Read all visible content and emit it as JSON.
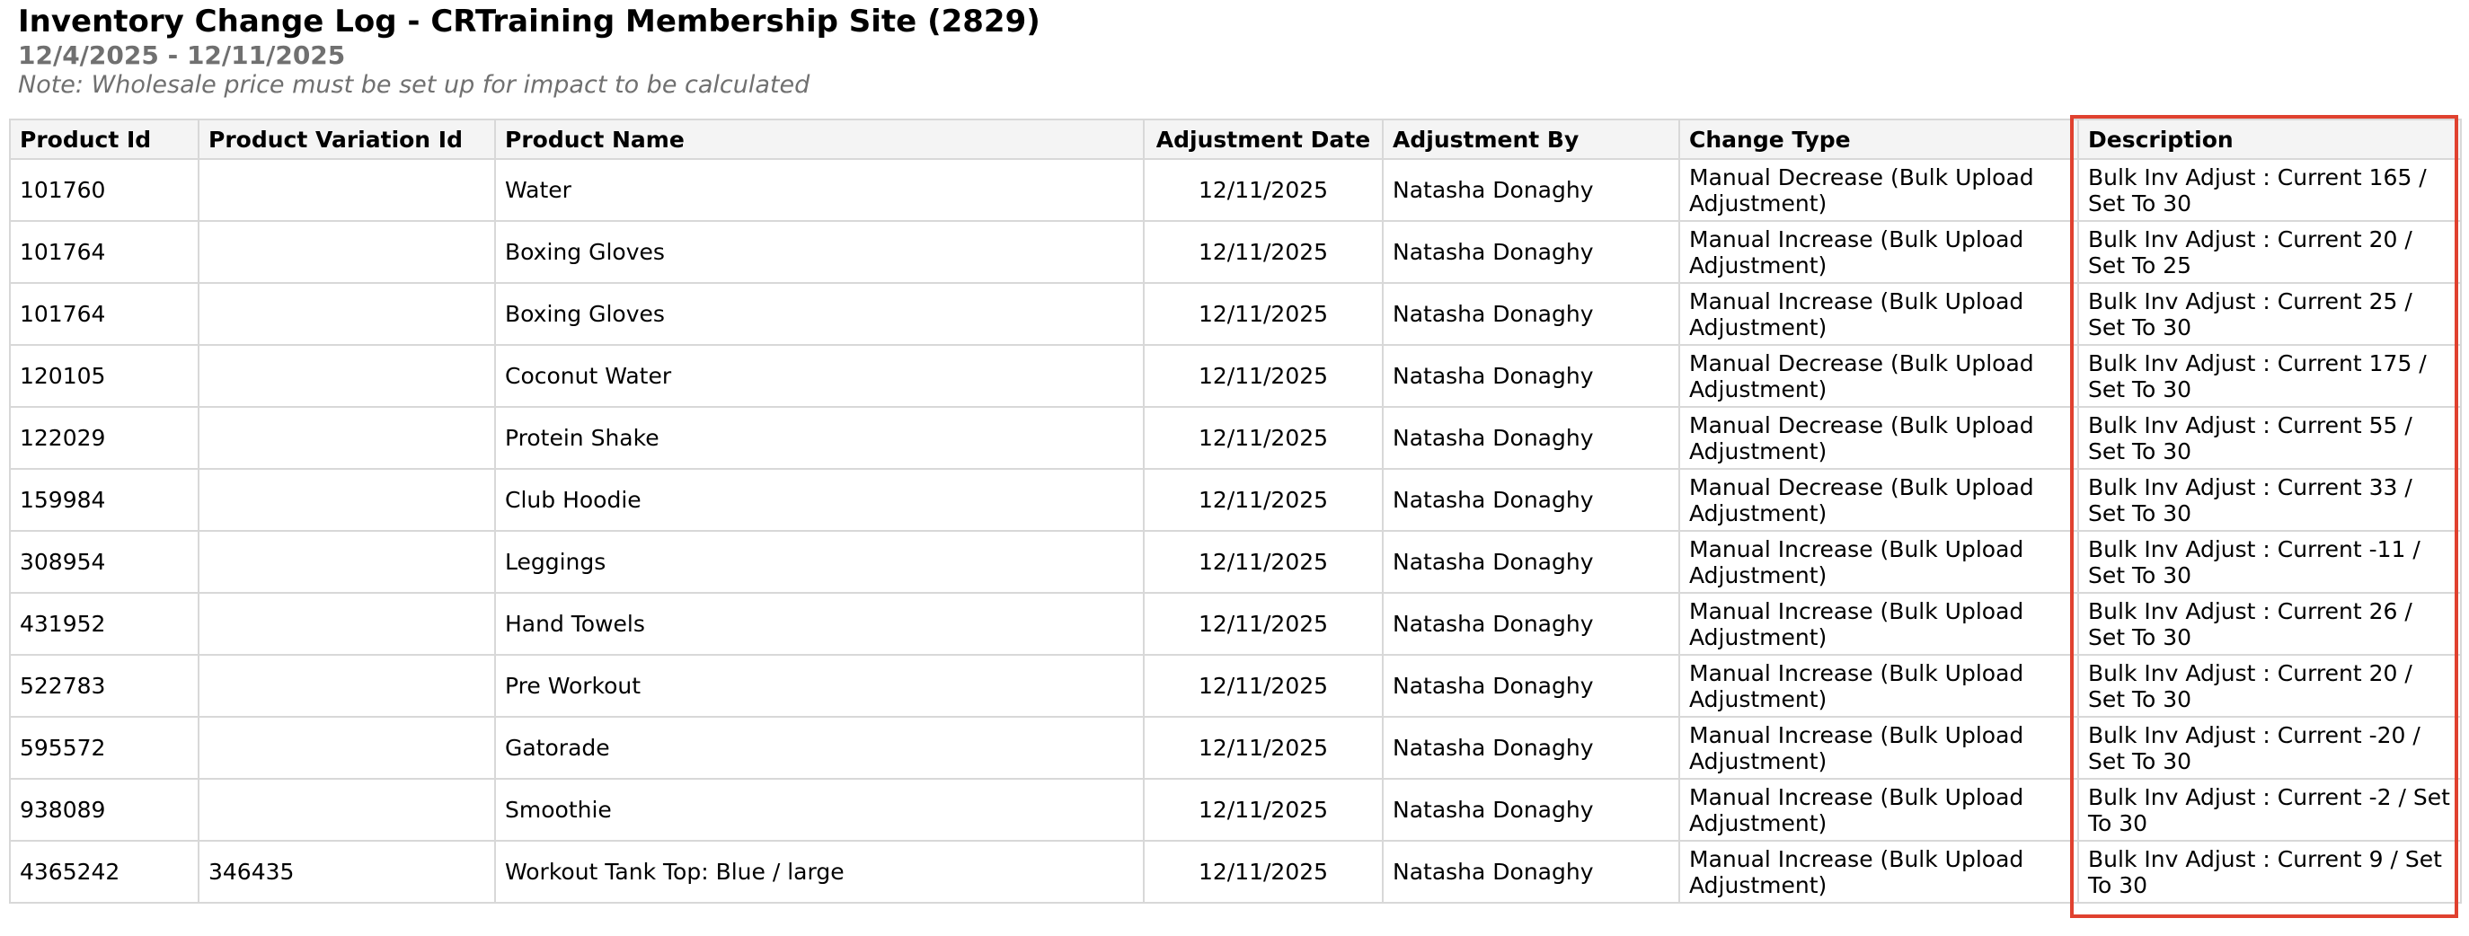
{
  "report": {
    "title": "Inventory Change Log - CRTraining Membership Site (2829)",
    "date_range": "12/4/2025 - 12/11/2025",
    "note": "Note: Wholesale price must be set up for impact to be calculated"
  },
  "highlight_color": "#e0412f",
  "table": {
    "columns": [
      "Product Id",
      "Product Variation Id",
      "Product Name",
      "Adjustment Date",
      "Adjustment By",
      "Change Type",
      "Description"
    ],
    "rows": [
      {
        "product_id": "101760",
        "variation_id": "",
        "product_name": "Water",
        "date": "12/11/2025",
        "by": "Natasha Donaghy",
        "change_type": "Manual Decrease (Bulk Upload Adjustment)",
        "description": "Bulk Inv Adjust : Current 165 / Set To 30"
      },
      {
        "product_id": "101764",
        "variation_id": "",
        "product_name": "Boxing Gloves",
        "date": "12/11/2025",
        "by": "Natasha Donaghy",
        "change_type": "Manual Increase (Bulk Upload Adjustment)",
        "description": "Bulk Inv Adjust : Current 20 / Set To 25"
      },
      {
        "product_id": "101764",
        "variation_id": "",
        "product_name": "Boxing Gloves",
        "date": "12/11/2025",
        "by": "Natasha Donaghy",
        "change_type": "Manual Increase (Bulk Upload Adjustment)",
        "description": "Bulk Inv Adjust : Current 25 / Set To 30"
      },
      {
        "product_id": "120105",
        "variation_id": "",
        "product_name": "Coconut Water",
        "date": "12/11/2025",
        "by": "Natasha Donaghy",
        "change_type": "Manual Decrease (Bulk Upload Adjustment)",
        "description": "Bulk Inv Adjust : Current 175 / Set To 30"
      },
      {
        "product_id": "122029",
        "variation_id": "",
        "product_name": "Protein Shake",
        "date": "12/11/2025",
        "by": "Natasha Donaghy",
        "change_type": "Manual Decrease (Bulk Upload Adjustment)",
        "description": "Bulk Inv Adjust : Current 55 / Set To 30"
      },
      {
        "product_id": "159984",
        "variation_id": "",
        "product_name": "Club Hoodie",
        "date": "12/11/2025",
        "by": "Natasha Donaghy",
        "change_type": "Manual Decrease (Bulk Upload Adjustment)",
        "description": "Bulk Inv Adjust : Current 33 / Set To 30"
      },
      {
        "product_id": "308954",
        "variation_id": "",
        "product_name": "Leggings",
        "date": "12/11/2025",
        "by": "Natasha Donaghy",
        "change_type": "Manual Increase (Bulk Upload Adjustment)",
        "description": "Bulk Inv Adjust : Current -11 / Set To 30"
      },
      {
        "product_id": "431952",
        "variation_id": "",
        "product_name": "Hand Towels",
        "date": "12/11/2025",
        "by": "Natasha Donaghy",
        "change_type": "Manual Increase (Bulk Upload Adjustment)",
        "description": "Bulk Inv Adjust : Current 26 / Set To 30"
      },
      {
        "product_id": "522783",
        "variation_id": "",
        "product_name": "Pre Workout",
        "date": "12/11/2025",
        "by": "Natasha Donaghy",
        "change_type": "Manual Increase (Bulk Upload Adjustment)",
        "description": "Bulk Inv Adjust : Current 20 / Set To 30"
      },
      {
        "product_id": "595572",
        "variation_id": "",
        "product_name": "Gatorade",
        "date": "12/11/2025",
        "by": "Natasha Donaghy",
        "change_type": "Manual Increase (Bulk Upload Adjustment)",
        "description": "Bulk Inv Adjust : Current -20 / Set To 30"
      },
      {
        "product_id": "938089",
        "variation_id": "",
        "product_name": "Smoothie",
        "date": "12/11/2025",
        "by": "Natasha Donaghy",
        "change_type": "Manual Increase (Bulk Upload Adjustment)",
        "description": "Bulk Inv Adjust : Current -2 / Set To 30"
      },
      {
        "product_id": "4365242",
        "variation_id": "346435",
        "product_name": "Workout Tank Top: Blue / large",
        "date": "12/11/2025",
        "by": "Natasha Donaghy",
        "change_type": "Manual Increase (Bulk Upload Adjustment)",
        "description": "Bulk Inv Adjust : Current 9 / Set To 30"
      }
    ]
  }
}
